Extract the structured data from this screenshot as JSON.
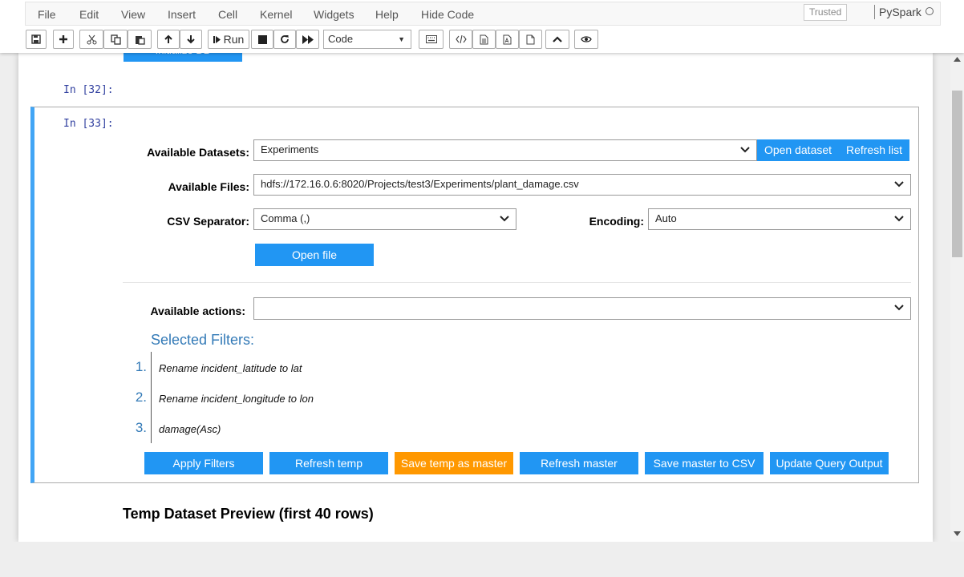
{
  "menubar": {
    "items": [
      "File",
      "Edit",
      "View",
      "Insert",
      "Cell",
      "Kernel",
      "Widgets",
      "Help",
      "Hide Code"
    ],
    "trusted": "Trusted",
    "kernel": "PySpark"
  },
  "toolbar": {
    "run_label": "Run",
    "cell_type": "Code",
    "icons": [
      "save-icon",
      "plus-icon",
      "cut-icon",
      "copy-icon",
      "paste-icon",
      "arrow-up-icon",
      "arrow-down-icon",
      "run-icon",
      "stop-icon",
      "restart-icon",
      "fast-forward-icon",
      "keyboard-icon",
      "code-icon",
      "document-icon",
      "pdf-icon",
      "file-icon",
      "chevron-up-icon",
      "eye-icon"
    ]
  },
  "notebook": {
    "partial_button": "Initialize DB",
    "prompt_32": "In [32]:",
    "prompt_33": "In [33]:",
    "widget": {
      "datasets_label": "Available Datasets:",
      "datasets_value": "Experiments",
      "open_dataset": "Open dataset",
      "refresh_list": "Refresh list",
      "files_label": "Available Files:",
      "files_value": "hdfs://172.16.0.6:8020/Projects/test3/Experiments/plant_damage.csv",
      "separator_label": "CSV Separator:",
      "separator_value": "Comma (,)",
      "encoding_label": "Encoding:",
      "encoding_value": "Auto",
      "open_file": "Open file",
      "actions_label": "Available actions:",
      "actions_value": "",
      "filters_title": "Selected Filters:",
      "filters": [
        {
          "num": "1.",
          "text": "Rename incident_latitude to lat"
        },
        {
          "num": "2.",
          "text": "Rename incident_longitude to lon"
        },
        {
          "num": "3.",
          "text": "damage(Asc)"
        }
      ],
      "buttons": [
        "Apply Filters",
        "Refresh temp",
        "Save temp as master",
        "Refresh master",
        "Save master to CSV",
        "Update Query Output"
      ]
    },
    "preview_heading": "Temp Dataset Preview (first 40 rows)"
  },
  "colors": {
    "accent": "#2196f3",
    "orange": "#ff9800",
    "cell_border": "#42a5f5",
    "prompt": "#303f9f",
    "filters_title": "#337ab7"
  }
}
